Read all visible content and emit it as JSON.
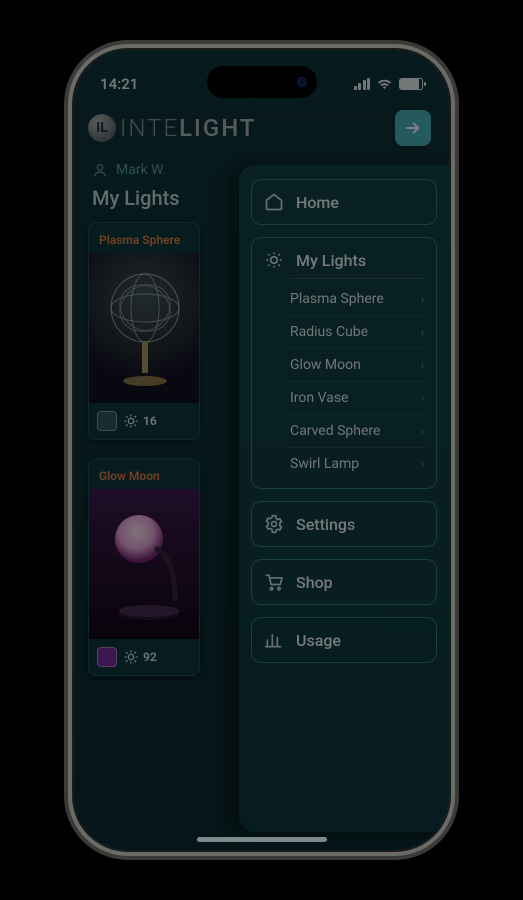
{
  "status": {
    "time": "14:21"
  },
  "brand": {
    "logo_letter": "IL",
    "prefix": "INTE",
    "suffix": "LIGHT"
  },
  "user": {
    "name": "Mark W."
  },
  "page": {
    "title": "My Lights"
  },
  "cards": [
    {
      "title": "Plasma Sphere",
      "brightness": 16,
      "swatch": "teal"
    },
    {
      "title": "Glow Moon",
      "brightness": 92,
      "swatch": "purple"
    }
  ],
  "drawer": {
    "home": "Home",
    "my_lights": "My Lights",
    "lights": [
      "Plasma Sphere",
      "Radius Cube",
      "Glow Moon",
      "Iron Vase",
      "Carved Sphere",
      "Swirl Lamp"
    ],
    "settings": "Settings",
    "shop": "Shop",
    "usage": "Usage"
  }
}
